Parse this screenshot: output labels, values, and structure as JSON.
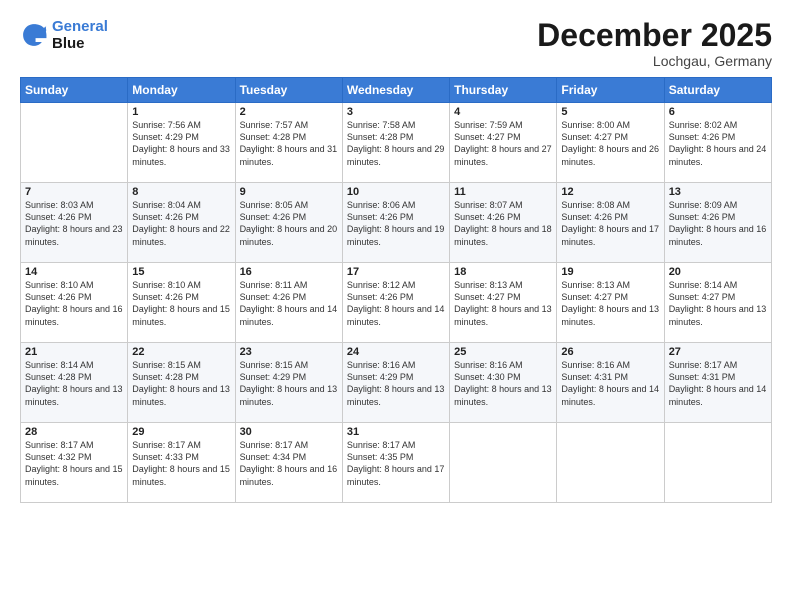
{
  "logo": {
    "line1": "General",
    "line2": "Blue"
  },
  "title": "December 2025",
  "location": "Lochgau, Germany",
  "weekdays": [
    "Sunday",
    "Monday",
    "Tuesday",
    "Wednesday",
    "Thursday",
    "Friday",
    "Saturday"
  ],
  "weeks": [
    [
      {
        "day": "",
        "sunrise": "",
        "sunset": "",
        "daylight": ""
      },
      {
        "day": "1",
        "sunrise": "Sunrise: 7:56 AM",
        "sunset": "Sunset: 4:29 PM",
        "daylight": "Daylight: 8 hours and 33 minutes."
      },
      {
        "day": "2",
        "sunrise": "Sunrise: 7:57 AM",
        "sunset": "Sunset: 4:28 PM",
        "daylight": "Daylight: 8 hours and 31 minutes."
      },
      {
        "day": "3",
        "sunrise": "Sunrise: 7:58 AM",
        "sunset": "Sunset: 4:28 PM",
        "daylight": "Daylight: 8 hours and 29 minutes."
      },
      {
        "day": "4",
        "sunrise": "Sunrise: 7:59 AM",
        "sunset": "Sunset: 4:27 PM",
        "daylight": "Daylight: 8 hours and 27 minutes."
      },
      {
        "day": "5",
        "sunrise": "Sunrise: 8:00 AM",
        "sunset": "Sunset: 4:27 PM",
        "daylight": "Daylight: 8 hours and 26 minutes."
      },
      {
        "day": "6",
        "sunrise": "Sunrise: 8:02 AM",
        "sunset": "Sunset: 4:26 PM",
        "daylight": "Daylight: 8 hours and 24 minutes."
      }
    ],
    [
      {
        "day": "7",
        "sunrise": "Sunrise: 8:03 AM",
        "sunset": "Sunset: 4:26 PM",
        "daylight": "Daylight: 8 hours and 23 minutes."
      },
      {
        "day": "8",
        "sunrise": "Sunrise: 8:04 AM",
        "sunset": "Sunset: 4:26 PM",
        "daylight": "Daylight: 8 hours and 22 minutes."
      },
      {
        "day": "9",
        "sunrise": "Sunrise: 8:05 AM",
        "sunset": "Sunset: 4:26 PM",
        "daylight": "Daylight: 8 hours and 20 minutes."
      },
      {
        "day": "10",
        "sunrise": "Sunrise: 8:06 AM",
        "sunset": "Sunset: 4:26 PM",
        "daylight": "Daylight: 8 hours and 19 minutes."
      },
      {
        "day": "11",
        "sunrise": "Sunrise: 8:07 AM",
        "sunset": "Sunset: 4:26 PM",
        "daylight": "Daylight: 8 hours and 18 minutes."
      },
      {
        "day": "12",
        "sunrise": "Sunrise: 8:08 AM",
        "sunset": "Sunset: 4:26 PM",
        "daylight": "Daylight: 8 hours and 17 minutes."
      },
      {
        "day": "13",
        "sunrise": "Sunrise: 8:09 AM",
        "sunset": "Sunset: 4:26 PM",
        "daylight": "Daylight: 8 hours and 16 minutes."
      }
    ],
    [
      {
        "day": "14",
        "sunrise": "Sunrise: 8:10 AM",
        "sunset": "Sunset: 4:26 PM",
        "daylight": "Daylight: 8 hours and 16 minutes."
      },
      {
        "day": "15",
        "sunrise": "Sunrise: 8:10 AM",
        "sunset": "Sunset: 4:26 PM",
        "daylight": "Daylight: 8 hours and 15 minutes."
      },
      {
        "day": "16",
        "sunrise": "Sunrise: 8:11 AM",
        "sunset": "Sunset: 4:26 PM",
        "daylight": "Daylight: 8 hours and 14 minutes."
      },
      {
        "day": "17",
        "sunrise": "Sunrise: 8:12 AM",
        "sunset": "Sunset: 4:26 PM",
        "daylight": "Daylight: 8 hours and 14 minutes."
      },
      {
        "day": "18",
        "sunrise": "Sunrise: 8:13 AM",
        "sunset": "Sunset: 4:27 PM",
        "daylight": "Daylight: 8 hours and 13 minutes."
      },
      {
        "day": "19",
        "sunrise": "Sunrise: 8:13 AM",
        "sunset": "Sunset: 4:27 PM",
        "daylight": "Daylight: 8 hours and 13 minutes."
      },
      {
        "day": "20",
        "sunrise": "Sunrise: 8:14 AM",
        "sunset": "Sunset: 4:27 PM",
        "daylight": "Daylight: 8 hours and 13 minutes."
      }
    ],
    [
      {
        "day": "21",
        "sunrise": "Sunrise: 8:14 AM",
        "sunset": "Sunset: 4:28 PM",
        "daylight": "Daylight: 8 hours and 13 minutes."
      },
      {
        "day": "22",
        "sunrise": "Sunrise: 8:15 AM",
        "sunset": "Sunset: 4:28 PM",
        "daylight": "Daylight: 8 hours and 13 minutes."
      },
      {
        "day": "23",
        "sunrise": "Sunrise: 8:15 AM",
        "sunset": "Sunset: 4:29 PM",
        "daylight": "Daylight: 8 hours and 13 minutes."
      },
      {
        "day": "24",
        "sunrise": "Sunrise: 8:16 AM",
        "sunset": "Sunset: 4:29 PM",
        "daylight": "Daylight: 8 hours and 13 minutes."
      },
      {
        "day": "25",
        "sunrise": "Sunrise: 8:16 AM",
        "sunset": "Sunset: 4:30 PM",
        "daylight": "Daylight: 8 hours and 13 minutes."
      },
      {
        "day": "26",
        "sunrise": "Sunrise: 8:16 AM",
        "sunset": "Sunset: 4:31 PM",
        "daylight": "Daylight: 8 hours and 14 minutes."
      },
      {
        "day": "27",
        "sunrise": "Sunrise: 8:17 AM",
        "sunset": "Sunset: 4:31 PM",
        "daylight": "Daylight: 8 hours and 14 minutes."
      }
    ],
    [
      {
        "day": "28",
        "sunrise": "Sunrise: 8:17 AM",
        "sunset": "Sunset: 4:32 PM",
        "daylight": "Daylight: 8 hours and 15 minutes."
      },
      {
        "day": "29",
        "sunrise": "Sunrise: 8:17 AM",
        "sunset": "Sunset: 4:33 PM",
        "daylight": "Daylight: 8 hours and 15 minutes."
      },
      {
        "day": "30",
        "sunrise": "Sunrise: 8:17 AM",
        "sunset": "Sunset: 4:34 PM",
        "daylight": "Daylight: 8 hours and 16 minutes."
      },
      {
        "day": "31",
        "sunrise": "Sunrise: 8:17 AM",
        "sunset": "Sunset: 4:35 PM",
        "daylight": "Daylight: 8 hours and 17 minutes."
      },
      {
        "day": "",
        "sunrise": "",
        "sunset": "",
        "daylight": ""
      },
      {
        "day": "",
        "sunrise": "",
        "sunset": "",
        "daylight": ""
      },
      {
        "day": "",
        "sunrise": "",
        "sunset": "",
        "daylight": ""
      }
    ]
  ]
}
